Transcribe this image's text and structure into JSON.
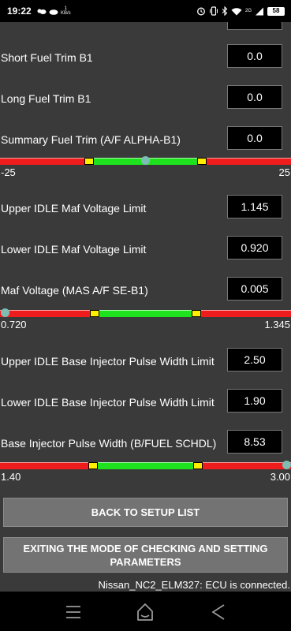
{
  "status_bar": {
    "time": "19:22",
    "net_speed_value": "1",
    "net_speed_unit": "KB/s",
    "network_label": "2G",
    "battery": "58"
  },
  "rows": [
    {
      "label": "Short Fuel Trim B1",
      "value": "0.0"
    },
    {
      "label": "Long Fuel Trim B1",
      "value": "0.0"
    },
    {
      "label": "Summary Fuel Trim (A/F ALPHA-B1)",
      "value": "0.0"
    },
    {
      "label": "Upper IDLE Maf Voltage Limit",
      "value": "1.145"
    },
    {
      "label": "Lower IDLE Maf Voltage Limit",
      "value": "0.920"
    },
    {
      "label": "Maf Voltage (MAS A/F SE-B1)",
      "value": "0.005"
    },
    {
      "label": "Upper IDLE Base Injector Pulse Width Limit",
      "value": "2.50"
    },
    {
      "label": "Lower IDLE Base Injector Pulse Width Limit",
      "value": "1.90"
    },
    {
      "label": "Base Injector Pulse Width (B/FUEL SCHDL)",
      "value": "8.53"
    }
  ],
  "gauges": [
    {
      "min": "-25",
      "max": "25",
      "lower": -10,
      "upper": 10,
      "current": 0,
      "range": [
        -25,
        25
      ]
    },
    {
      "min": "0.720",
      "max": "1.345",
      "lower": 0.92,
      "upper": 1.145,
      "current": 0.72,
      "range": [
        0.72,
        1.345
      ]
    },
    {
      "min": "1.40",
      "max": "3.00",
      "lower": 1.9,
      "upper": 2.5,
      "current": 3.0,
      "range": [
        1.4,
        3.0
      ]
    }
  ],
  "buttons": {
    "back": "BACK TO SETUP LIST",
    "exit": "EXITING THE MODE OF CHECKING AND SETTING PARAMETERS"
  },
  "connection_status": "Nissan_NC2_ELM327: ECU is connected.",
  "colors": {
    "background": "#3a3a3a",
    "gauge_red": "#ee1c1c",
    "gauge_green": "#1ee21e",
    "gauge_limit": "#ffee00",
    "gauge_indicator": "#7dbdb4",
    "button": "#737373"
  },
  "icons": [
    "alarm-icon",
    "vibrate-icon",
    "bluetooth-icon",
    "wifi-icon",
    "signal-icon",
    "battery-icon",
    "menu-icon",
    "home-icon",
    "back-icon"
  ]
}
